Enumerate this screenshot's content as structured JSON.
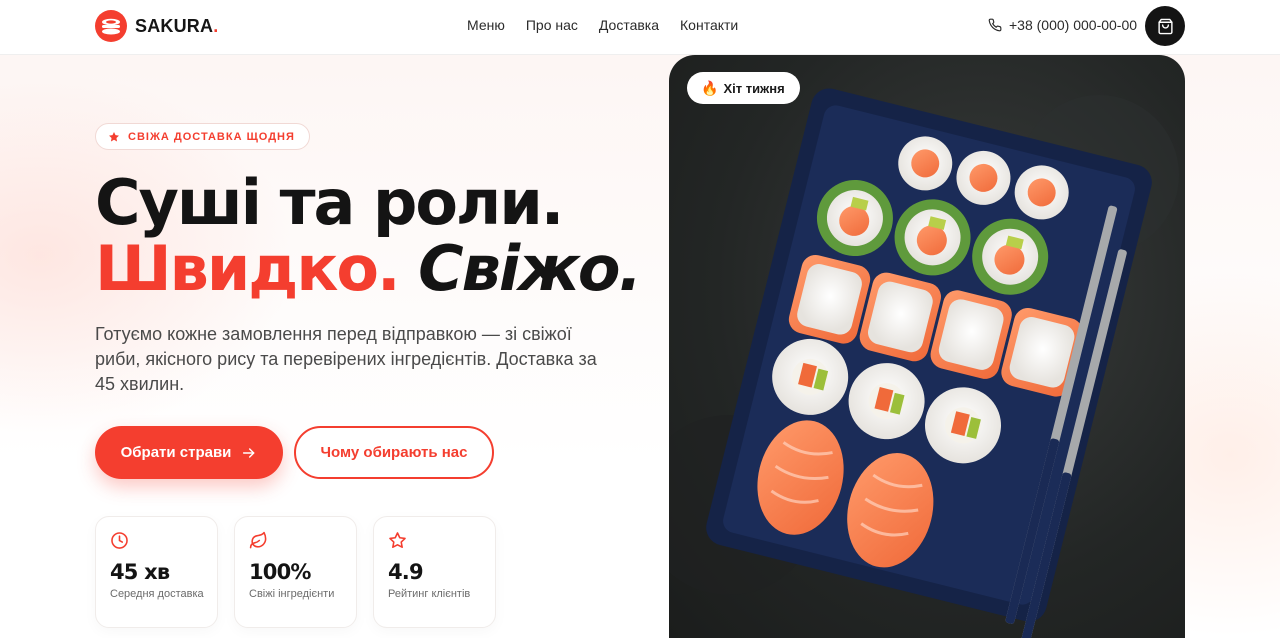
{
  "brand": {
    "name": "SAKURA",
    "dot": ".",
    "accent_color": "#f43e2f",
    "logo_icon": "sushi-roll-logo"
  },
  "nav": {
    "items": [
      "Меню",
      "Про нас",
      "Доставка",
      "Контакти"
    ]
  },
  "header": {
    "phone": "+38 (000) 000-00-00",
    "phone_icon": "phone-icon",
    "cart_icon": "shopping-bag-icon"
  },
  "hero": {
    "badge": "СВІЖА ДОСТАВКА ЩОДНЯ",
    "title_line1": "Суші та роли.",
    "title_red": "Швидко.",
    "title_italic": "Свіжо.",
    "lead": "Готуємо кожне замовлення перед відправкою — зі свіжої риби, якісного рису та перевірених інгредієнтів. Доставка за 45 хвилин.",
    "primary_cta": "Обрати страви",
    "secondary_cta": "Чому обирають нас"
  },
  "stats": [
    {
      "icon": "clock-icon",
      "value": "45 хв",
      "label": "Середня доставка"
    },
    {
      "icon": "leaf-icon",
      "value": "100%",
      "label": "Свіжі інгредієнти"
    },
    {
      "icon": "star-icon",
      "value": "4.9",
      "label": "Рейтинг клієнтів"
    }
  ],
  "image": {
    "badge_emoji": "🔥",
    "badge_text": "Хіт тижня"
  }
}
